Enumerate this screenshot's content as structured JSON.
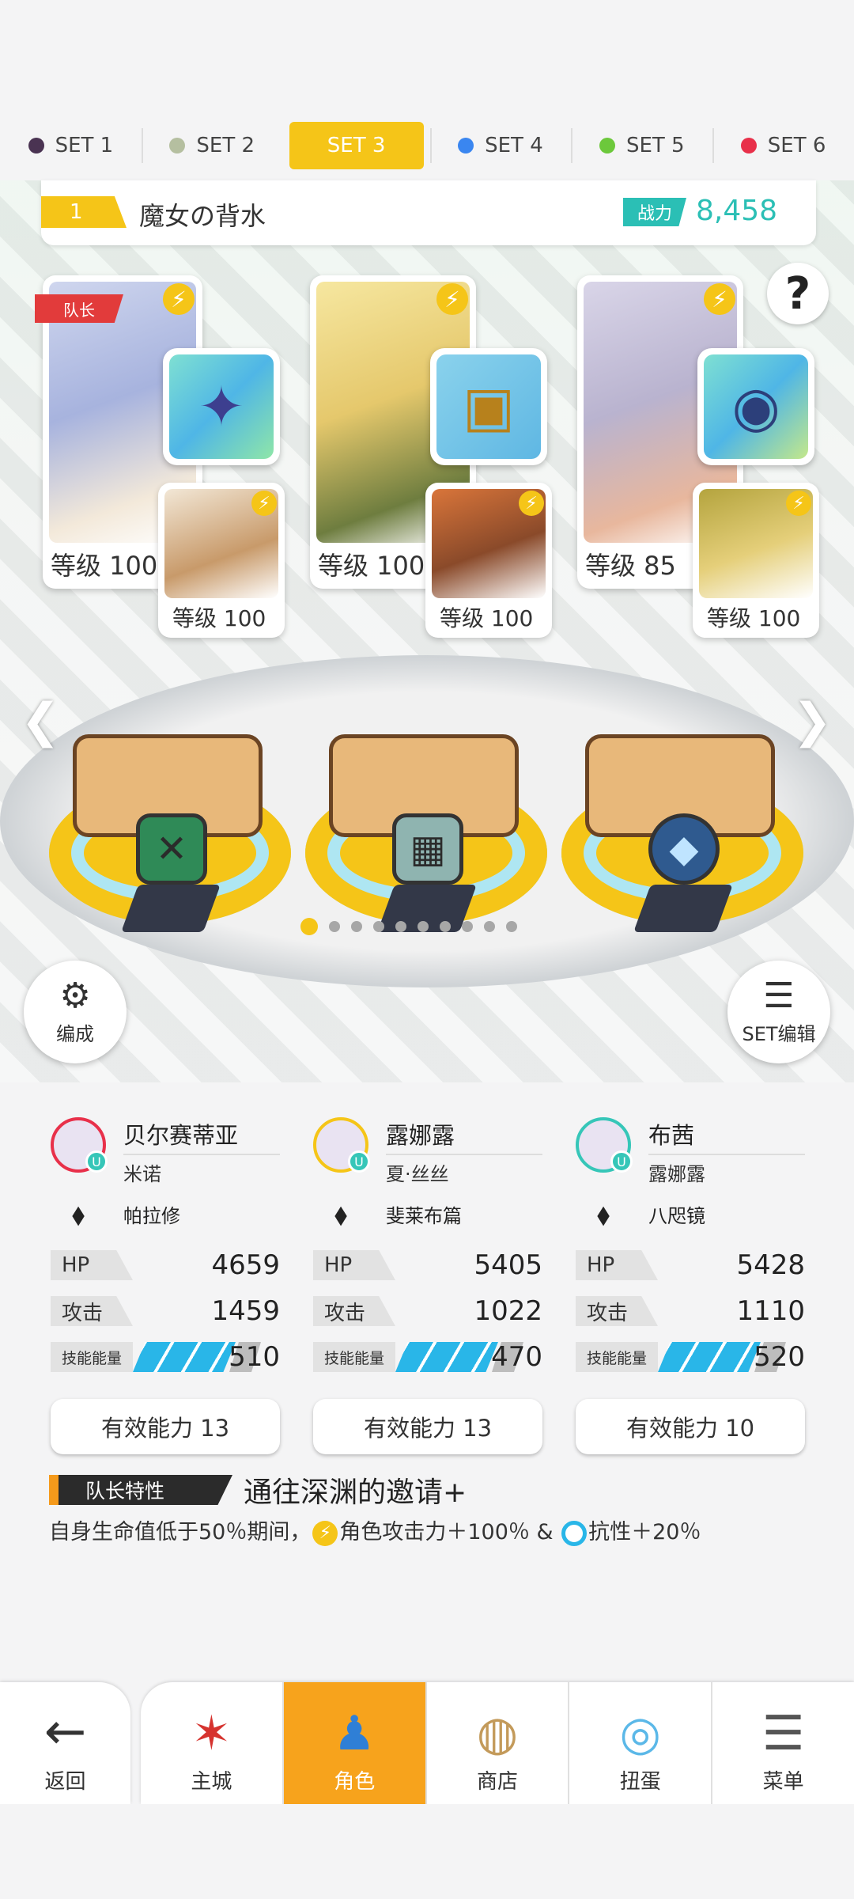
{
  "set_tabs": [
    {
      "label": "SET 1",
      "color": "#4a3352"
    },
    {
      "label": "SET 2",
      "color": "#b5bfa0"
    },
    {
      "label": "SET 3",
      "color": "#f5c518",
      "active": true
    },
    {
      "label": "SET 4",
      "color": "#3a86f0"
    },
    {
      "label": "SET 5",
      "color": "#6cc83b"
    },
    {
      "label": "SET 6",
      "color": "#e8304a"
    }
  ],
  "team": {
    "number": "1",
    "name": "魔女の背水",
    "power_label": "战力",
    "power_value": "8,458"
  },
  "help_label": "?",
  "leader_badge": "队长",
  "cards": [
    {
      "level": "等级 100",
      "support_level": "等级 100"
    },
    {
      "level": "等级 100",
      "support_level": "等级 100"
    },
    {
      "level": "等级 85",
      "support_level": "等级 100"
    }
  ],
  "buttons": {
    "formation": "编成",
    "set_edit": "SET编辑"
  },
  "colors": {
    "accent": "#f5c518",
    "teal": "#2bbfb5",
    "nav_active": "#f7a31c",
    "energy": "#29b6e8"
  },
  "characters": [
    {
      "name": "贝尔赛蒂亚",
      "support": "米诺",
      "weapon": "帕拉修",
      "hp_label": "HP",
      "hp": "4659",
      "atk_label": "攻击",
      "atk": "1459",
      "energy_label": "技能能量",
      "energy": "510",
      "ability": "有效能力 13",
      "ring": "#e8304a"
    },
    {
      "name": "露娜露",
      "support": "夏·丝丝",
      "weapon": "斐莱布篇",
      "hp_label": "HP",
      "hp": "5405",
      "atk_label": "攻击",
      "atk": "1022",
      "energy_label": "技能能量",
      "energy": "470",
      "ability": "有效能力 13",
      "ring": "#f5c518"
    },
    {
      "name": "布茜",
      "support": "露娜露",
      "weapon": "八咫镜",
      "hp_label": "HP",
      "hp": "5428",
      "atk_label": "攻击",
      "atk": "1110",
      "energy_label": "技能能量",
      "energy": "520",
      "ability": "有效能力 10",
      "ring": "#36c6b8"
    }
  ],
  "leader_trait": {
    "tag": "队长特性",
    "name": "通往深渊的邀请+",
    "desc_part1": "自身生命值低于50％期间，",
    "desc_part2": "角色攻击力＋100％ & ",
    "desc_part3": "抗性＋20％"
  },
  "nav": {
    "back": "返回",
    "tabs": [
      "主城",
      "角色",
      "商店",
      "扭蛋",
      "菜单"
    ]
  }
}
